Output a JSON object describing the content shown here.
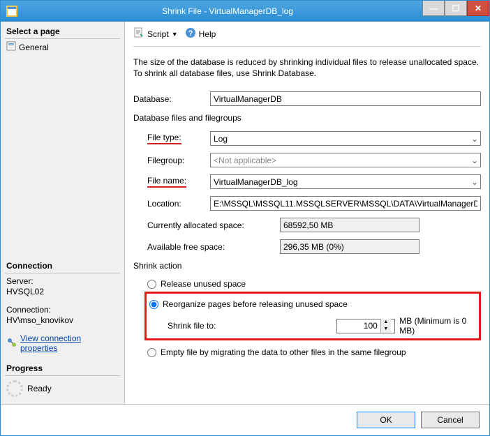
{
  "window": {
    "title": "Shrink File - VirtualManagerDB_log"
  },
  "sidebar": {
    "header": "Select a page",
    "items": [
      {
        "label": "General"
      }
    ],
    "connection_header": "Connection",
    "server_label": "Server:",
    "server_value": "HVSQL02",
    "connection_label": "Connection:",
    "connection_value": "HV\\mso_knovikov",
    "view_link": "View connection properties",
    "progress_header": "Progress",
    "progress_status": "Ready"
  },
  "toolbar": {
    "script": "Script",
    "help": "Help"
  },
  "main": {
    "description": "The size of the database is reduced by shrinking individual files to release unallocated space. To shrink all database files, use Shrink Database.",
    "database_label": "Database:",
    "database_value": "VirtualManagerDB",
    "files_section": "Database files and filegroups",
    "file_type_label": "File type:",
    "file_type_value": "Log",
    "filegroup_label": "Filegroup:",
    "filegroup_value": "<Not applicable>",
    "file_name_label": "File name:",
    "file_name_value": "VirtualManagerDB_log",
    "location_label": "Location:",
    "location_value": "E:\\MSSQL\\MSSQL11.MSSQLSERVER\\MSSQL\\DATA\\VirtualManagerDB_",
    "alloc_label": "Currently allocated space:",
    "alloc_value": "68592,50 MB",
    "free_label": "Available free space:",
    "free_value": "296,35 MB (0%)",
    "shrink_action": "Shrink action",
    "opt_release": "Release unused space",
    "opt_reorg": "Reorganize pages before releasing unused space",
    "shrink_to_label": "Shrink file to:",
    "shrink_to_value": "100",
    "shrink_to_suffix": "MB (Minimum is 0 MB)",
    "opt_empty": "Empty file by migrating the data to other files in the same filegroup"
  },
  "buttons": {
    "ok": "OK",
    "cancel": "Cancel"
  }
}
